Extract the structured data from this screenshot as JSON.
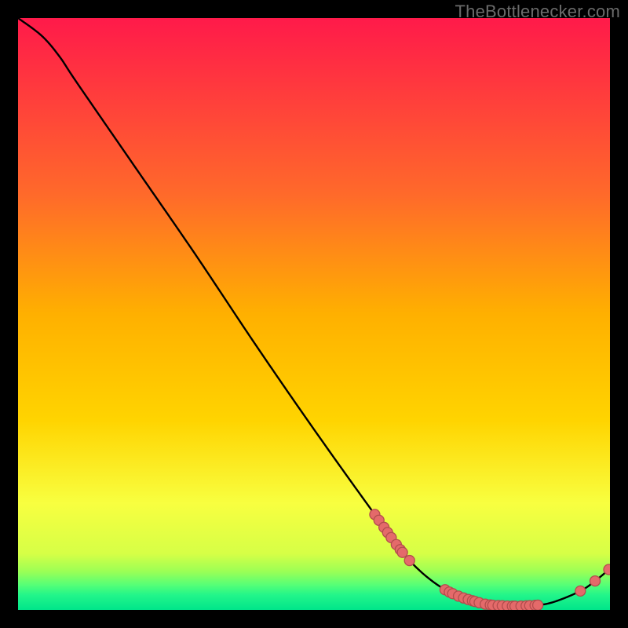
{
  "watermark": "TheBottlenecker.com",
  "colors": {
    "bg": "#000000",
    "grad_top": "#ff1a4a",
    "grad_mid_top": "#ff7a2a",
    "grad_mid": "#ffd400",
    "grad_low": "#f4ff3a",
    "grad_green1": "#8bff5a",
    "grad_green2": "#2dff8f",
    "grad_bottom": "#00e58a",
    "curve": "#000000",
    "dot_fill": "#e46a6a",
    "dot_stroke": "#b34d4d"
  },
  "chart_data": {
    "type": "line",
    "title": "",
    "xlabel": "",
    "ylabel": "",
    "xlim": [
      0,
      100
    ],
    "ylim": [
      0,
      100
    ],
    "curve": [
      {
        "x": 0,
        "y": 100
      },
      {
        "x": 4,
        "y": 97
      },
      {
        "x": 7,
        "y": 93.5
      },
      {
        "x": 10,
        "y": 89
      },
      {
        "x": 20,
        "y": 74.5
      },
      {
        "x": 30,
        "y": 60
      },
      {
        "x": 40,
        "y": 45
      },
      {
        "x": 50,
        "y": 30.5
      },
      {
        "x": 60,
        "y": 16.5
      },
      {
        "x": 66,
        "y": 8.5
      },
      {
        "x": 72,
        "y": 3.5
      },
      {
        "x": 78,
        "y": 1.2
      },
      {
        "x": 82,
        "y": 0.7
      },
      {
        "x": 86,
        "y": 0.7
      },
      {
        "x": 90,
        "y": 1.2
      },
      {
        "x": 95,
        "y": 3.2
      },
      {
        "x": 98,
        "y": 5.3
      },
      {
        "x": 100,
        "y": 7.0
      }
    ],
    "dot_clusters": [
      {
        "along_from": 60,
        "along_to": 66,
        "count": 9,
        "jitter": 0.35
      },
      {
        "along_from": 72,
        "along_to": 88,
        "count": 22,
        "jitter": 0.25
      },
      {
        "along_from": 94.5,
        "along_to": 95.5,
        "count": 1,
        "jitter": 0.0
      },
      {
        "along_from": 97.5,
        "along_to": 100,
        "count": 2,
        "jitter": 0.3
      }
    ],
    "dot_radius": 6.5
  }
}
